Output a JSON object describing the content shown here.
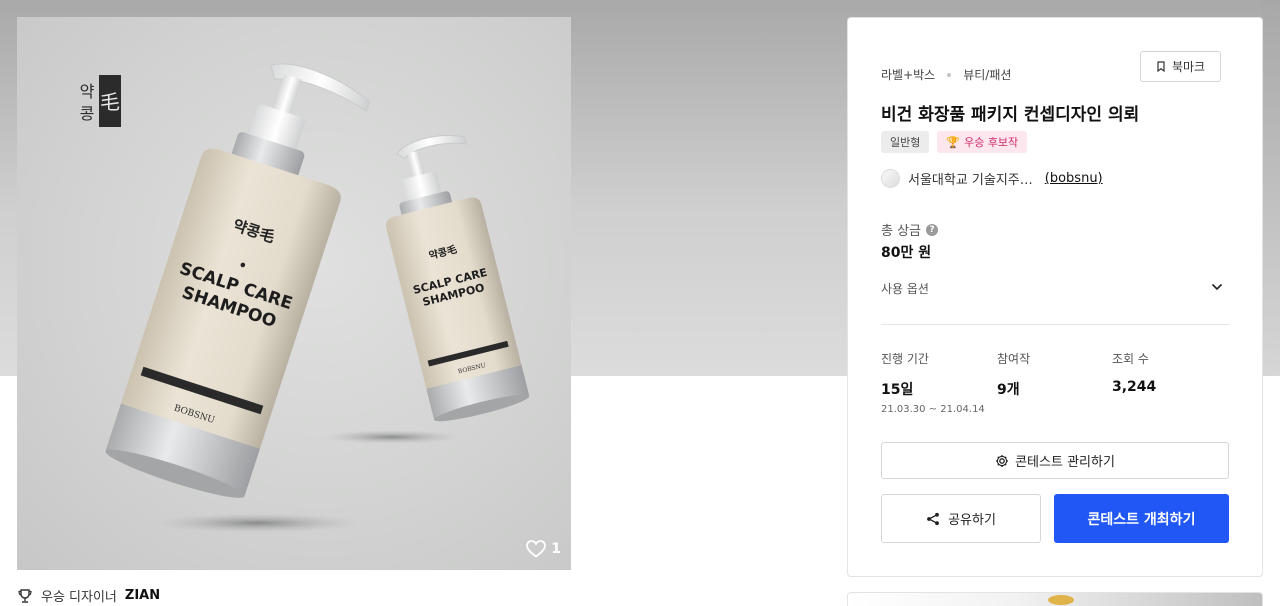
{
  "gallery": {
    "likes": "1",
    "brand_mark": "약콩毛",
    "product_text": {
      "line1": "SCALP CARE",
      "line2": "SHAMPOO",
      "brand": "BOBSNU"
    }
  },
  "winner": {
    "label": "우승 디자이너",
    "name": "ZIAN"
  },
  "contest": {
    "category": "라벨+박스",
    "subcategory": "뷰티/패션",
    "bookmark_label": "북마크",
    "title": "비건 화장품 패키지 컨셉디자인 의뢰",
    "tags": [
      {
        "label": "일반형"
      },
      {
        "label": "우승 후보작"
      }
    ],
    "host_name": "서울대학교 기술지주…",
    "host_handle": "(bobsnu)",
    "prize_label": "총 상금",
    "prize_value": "80만 원",
    "usage_label": "사용 옵션",
    "stats": [
      {
        "label": "진행 기간",
        "value": "15일",
        "sub": "21.03.30 ~ 21.04.14"
      },
      {
        "label": "참여작",
        "value": "9개",
        "sub": ""
      },
      {
        "label": "조회 수",
        "value": "3,244",
        "sub": ""
      }
    ],
    "manage_label": "콘테스트 관리하기",
    "share_label": "공유하기",
    "host_contest_label": "콘테스트 개최하기"
  },
  "colors": {
    "primary": "#2057f5",
    "award_text": "#d12b6b",
    "award_bg": "#fde7ef"
  }
}
